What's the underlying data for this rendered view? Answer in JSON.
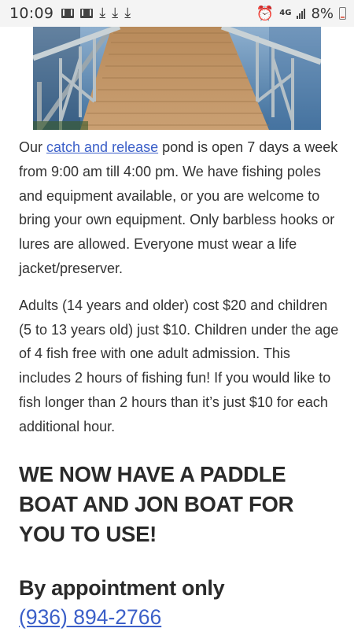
{
  "status_bar": {
    "time": "10:09",
    "left_icons": [
      "gmail-icon",
      "gmail-icon",
      "download-icon",
      "download-icon",
      "download-icon"
    ],
    "right_icons": [
      "alarm-icon",
      "lte-icon",
      "signal-icon",
      "battery-icon"
    ],
    "network_label": "4G",
    "battery_percent": "8%"
  },
  "hero": {
    "image_name": "dock-pier-photo"
  },
  "content": {
    "p1_before_link": "Our ",
    "p1_link": "catch and release",
    "p1_after_link": " pond is open 7 days a week from 9:00 am till 4:00 pm.  We have fishing poles and equipment available, or you are welcome to bring your own equipment. Only barbless hooks or lures are allowed. Everyone must wear a life jacket/preserver.",
    "p2": "Adults (14 years and older) cost $20 and children (5 to 13 years old) just $10.  Children under the age of 4 fish free with one adult admission. This includes 2 hours of fishing fun!  If you would like to fish longer than 2 hours than it’s just $10 for each additional hour.",
    "headline": "WE NOW HAVE A PADDLE BOAT AND JON BOAT FOR YOU TO USE!",
    "appointment": "By appointment only",
    "phone": "(936) 894-2766"
  },
  "colors": {
    "link": "#3b5fc8",
    "text": "#333333",
    "status_bar_bg": "#f4f4f4"
  }
}
